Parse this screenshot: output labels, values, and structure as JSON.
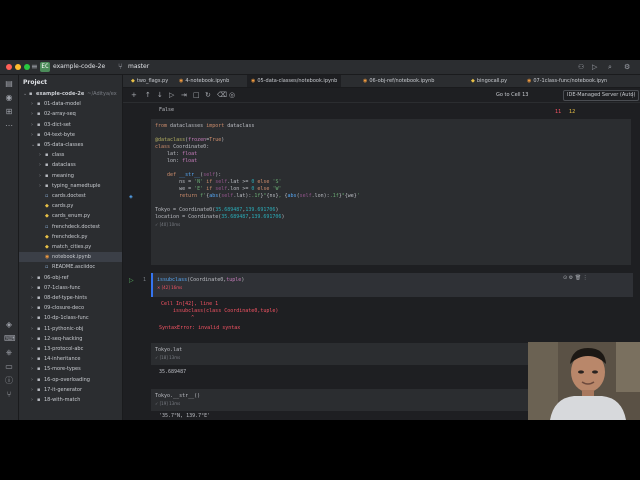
{
  "titlebar": {
    "project_badge": "EC",
    "project_name": "example-code-2e",
    "branch": "master"
  },
  "project_panel": {
    "header": "Project",
    "items": [
      {
        "label": "example-code-2e",
        "suffix": "~/Aditya/ex",
        "indent": 0,
        "type": "folder",
        "open": true
      },
      {
        "label": "01-data-model",
        "indent": 1,
        "type": "folder"
      },
      {
        "label": "02-array-seq",
        "indent": 1,
        "type": "folder"
      },
      {
        "label": "03-dict-set",
        "indent": 1,
        "type": "folder"
      },
      {
        "label": "04-text-byte",
        "indent": 1,
        "type": "folder"
      },
      {
        "label": "05-data-classes",
        "indent": 1,
        "type": "folder",
        "open": true
      },
      {
        "label": "class",
        "indent": 2,
        "type": "folder"
      },
      {
        "label": "dataclass",
        "indent": 2,
        "type": "folder"
      },
      {
        "label": "meaning",
        "indent": 2,
        "type": "folder"
      },
      {
        "label": "typing_namedtuple",
        "indent": 2,
        "type": "folder"
      },
      {
        "label": "cards.doctest",
        "indent": 2,
        "type": "doc"
      },
      {
        "label": "cards.py",
        "indent": 2,
        "type": "py"
      },
      {
        "label": "cards_enum.py",
        "indent": 2,
        "type": "py"
      },
      {
        "label": "frenchdeck.doctest",
        "indent": 2,
        "type": "doc"
      },
      {
        "label": "frenchdeck.py",
        "indent": 2,
        "type": "py"
      },
      {
        "label": "match_cities.py",
        "indent": 2,
        "type": "py"
      },
      {
        "label": "notebook.ipynb",
        "indent": 2,
        "type": "nb",
        "selected": true
      },
      {
        "label": "README.asciidoc",
        "indent": 2,
        "type": "doc"
      },
      {
        "label": "06-obj-ref",
        "indent": 1,
        "type": "folder"
      },
      {
        "label": "07-1class-func",
        "indent": 1,
        "type": "folder"
      },
      {
        "label": "08-def-type-hints",
        "indent": 1,
        "type": "folder"
      },
      {
        "label": "09-closure-deco",
        "indent": 1,
        "type": "folder"
      },
      {
        "label": "10-dp-1class-func",
        "indent": 1,
        "type": "folder"
      },
      {
        "label": "11-pythonic-obj",
        "indent": 1,
        "type": "folder"
      },
      {
        "label": "12-seq-hacking",
        "indent": 1,
        "type": "folder"
      },
      {
        "label": "13-protocol-abc",
        "indent": 1,
        "type": "folder"
      },
      {
        "label": "14-inheritance",
        "indent": 1,
        "type": "folder"
      },
      {
        "label": "15-more-types",
        "indent": 1,
        "type": "folder"
      },
      {
        "label": "16-op-overloading",
        "indent": 1,
        "type": "folder"
      },
      {
        "label": "17-it-generator",
        "indent": 1,
        "type": "folder"
      },
      {
        "label": "18-with-match",
        "indent": 1,
        "type": "folder"
      }
    ]
  },
  "tabs": [
    {
      "label": "two_flags.py",
      "type": "py"
    },
    {
      "label": "4-notebook.ipynb",
      "type": "nb"
    },
    {
      "label": "05-data-classes/notebook.ipynb",
      "type": "nb",
      "active": true
    },
    {
      "label": "06-obj-ref/notebook.ipynb",
      "type": "nb"
    },
    {
      "label": "bingocall.py",
      "type": "py"
    },
    {
      "label": "07-1class-func/notebook.ipyn",
      "type": "nb"
    }
  ],
  "nbtoolbar": {
    "goto": "Go to Cell 13",
    "server": "IDE-Managed Server (Auto)",
    "warnings": "11",
    "weak": "12"
  },
  "cells": {
    "prev_output": "False",
    "c1_exec": "✓ [40] 10ms",
    "c2_exec": "✕ [42] 16ms",
    "c2_err1": "Cell In[42], line 1",
    "c2_err2": "    issubclass(class Coordinate0,tuple)",
    "c2_err3": "          ^",
    "c2_err4": "SyntaxError: invalid syntax",
    "c2_gutter": "1",
    "c3_code": "Tokyo.lat",
    "c3_exec": "✓ [18] 13ms",
    "c3_out": "35.689487",
    "c4_code": "Tokyo.__str__()",
    "c4_exec": "✓ [19] 13ms",
    "c4_out": "'35.7°N, 139.7°E'"
  }
}
